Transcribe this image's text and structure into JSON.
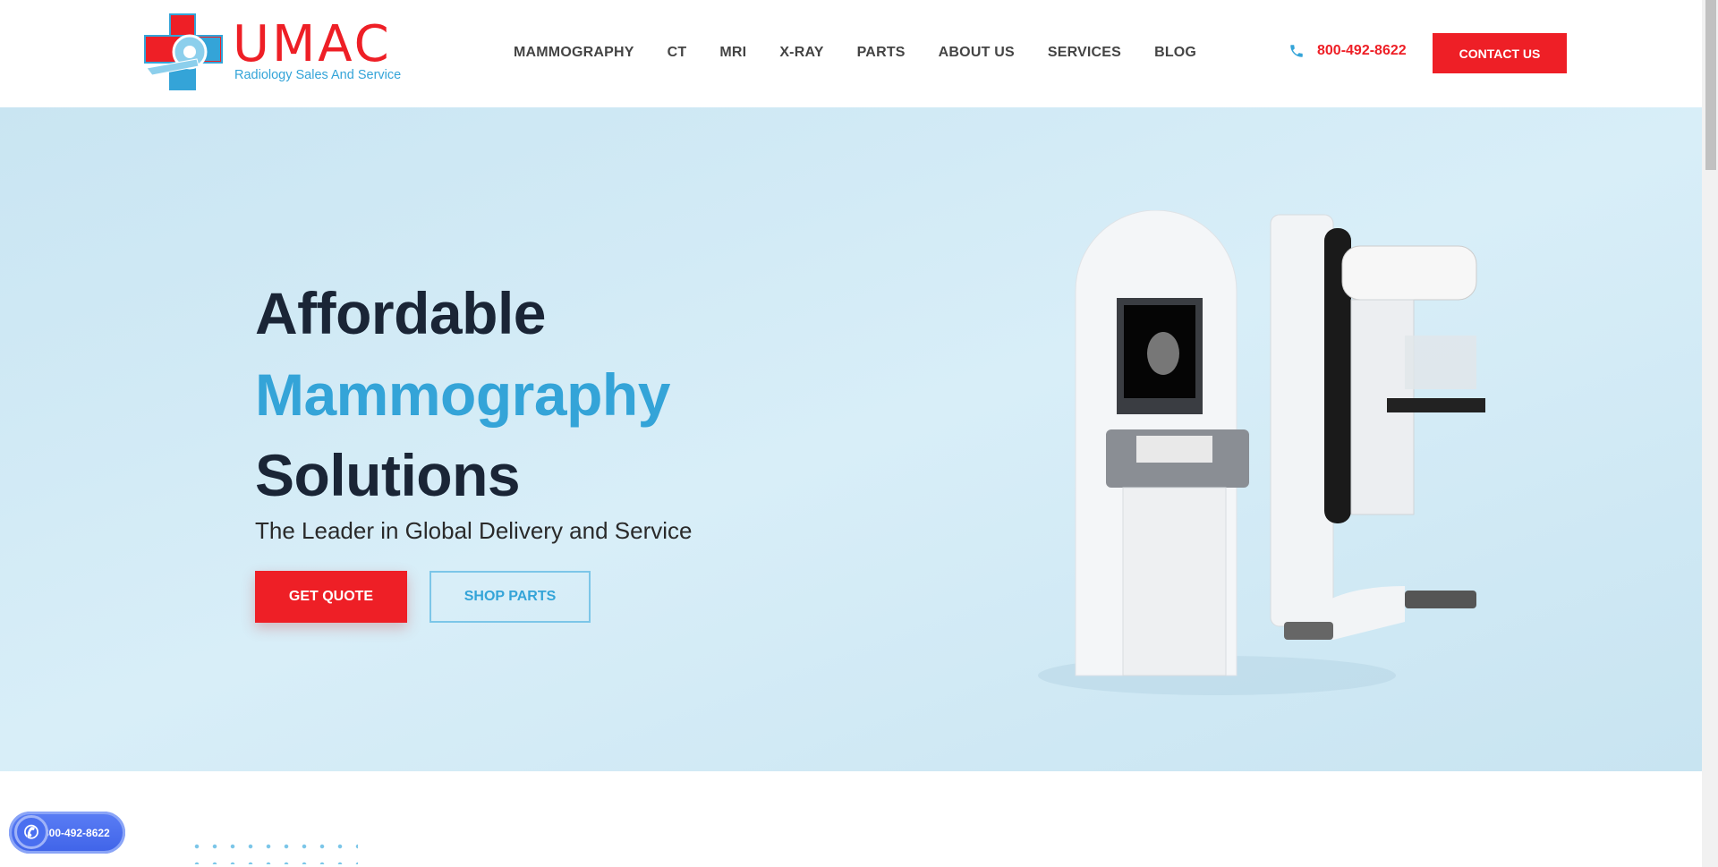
{
  "header": {
    "logo": {
      "title": "UMAC",
      "subtitle": "Radiology Sales And Service"
    },
    "nav": [
      {
        "label": "MAMMOGRAPHY"
      },
      {
        "label": "CT"
      },
      {
        "label": "MRI"
      },
      {
        "label": "X-RAY"
      },
      {
        "label": "PARTS"
      },
      {
        "label": "ABOUT US"
      },
      {
        "label": "SERVICES"
      },
      {
        "label": "BLOG"
      }
    ],
    "phone": "800-492-8622",
    "phone_icon": "phone-icon",
    "contact_label": "CONTACT US"
  },
  "hero": {
    "line1": "Affordable",
    "line2": "Mammography",
    "line3": "Solutions",
    "subtitle": "The Leader in Global Delivery and Service",
    "quote_label": "GET QUOTE",
    "parts_label": "SHOP PARTS"
  },
  "floating_call": {
    "phone": "800-492-8622"
  },
  "colors": {
    "brand_red": "#ee1f26",
    "brand_blue": "#34a4d8",
    "heading_dark": "#1a2536"
  }
}
